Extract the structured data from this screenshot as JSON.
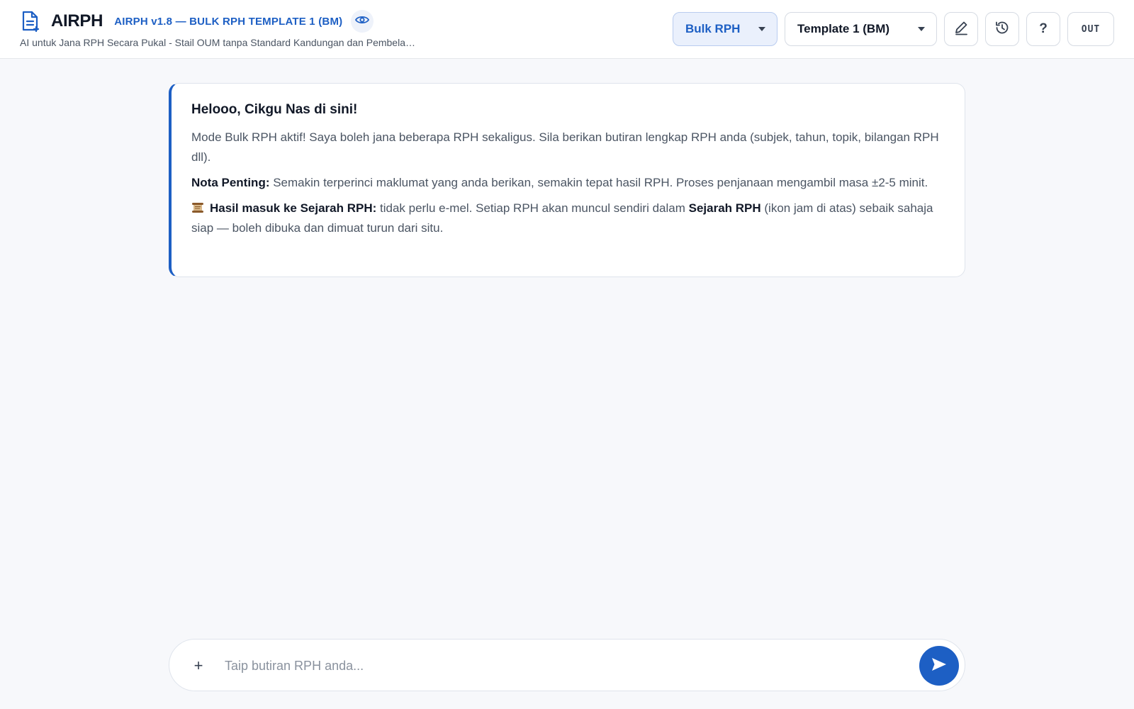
{
  "header": {
    "app_name": "AIRPH",
    "version_label": "AIRPH v1.8 — BULK RPH TEMPLATE 1 (BM)",
    "subtitle": "AI untuk Jana RPH Secara Pukal - Stail OUM tanpa Standard Kandungan dan Pembelajaran",
    "mode_select": "Bulk RPH",
    "template_select": "Template 1 (BM)",
    "help_label": "?",
    "logout_label": "OUT",
    "icons": [
      "document-icon",
      "eye-icon",
      "pencil-icon",
      "history-icon"
    ]
  },
  "message": {
    "greeting": "Helooo, Cikgu Nas di sini!",
    "intro": "Mode Bulk RPH aktif! Saya boleh jana beberapa RPH sekaligus. Sila berikan butiran lengkap RPH anda (subjek, tahun, topik, bilangan RPH dll).",
    "note_label": "Nota Penting:",
    "note_text": " Semakin terperinci maklumat yang anda berikan, semakin tepat hasil RPH. Proses penjanaan mengambil masa ±2-5 minit.",
    "history_label": "Hasil masuk ke Sejarah RPH:",
    "history_text_1": " tidak perlu e-mel. Setiap RPH akan muncul sendiri dalam ",
    "history_bold": "Sejarah RPH",
    "history_text_2": " (ikon jam di atas) sebaik sahaja siap — boleh dibuka dan dimuat turun dari situ."
  },
  "composer": {
    "attach_label": "+",
    "placeholder": "Taip butiran RPH anda...",
    "value": ""
  },
  "colors": {
    "accent": "#1d5fc4",
    "background": "#f7f8fb"
  }
}
